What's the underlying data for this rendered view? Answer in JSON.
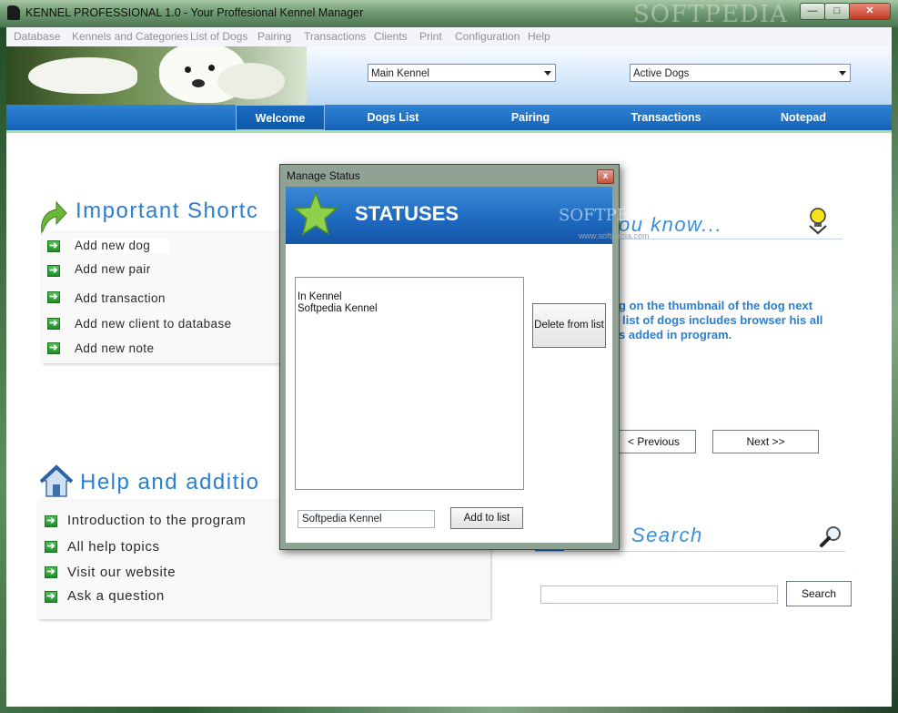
{
  "window": {
    "title": "KENNEL PROFESSIONAL 1.0 - Your Proffesional Kennel Manager",
    "watermark": "SOFTPEDIA",
    "minimize_glyph": "—",
    "maximize_glyph": "□",
    "close_glyph": "✕"
  },
  "menu": [
    "Database",
    "Kennels and Categories",
    "List of Dogs",
    "Pairing",
    "Transactions",
    "Clients",
    "Print",
    "Configuration",
    "Help"
  ],
  "header": {
    "kennel_select": "Main Kennel",
    "status_select": "Active Dogs"
  },
  "nav_tabs": [
    "Welcome",
    "Dogs List",
    "Pairing",
    "Transactions",
    "Notepad"
  ],
  "shortcuts": {
    "title": "Important Shortc",
    "items": [
      "Add new dog",
      "Add new pair",
      "Add transaction",
      "Add new client to database",
      "Add new note"
    ]
  },
  "help": {
    "title": "Help and additio",
    "items": [
      "Introduction to the program",
      "All help topics",
      "Visit our website",
      "Ask a question"
    ]
  },
  "did_you_know": {
    "title": "ou know...",
    "lines": [
      "g on the thumbnail of the dog next",
      "list of dogs includes browser his all",
      "s added in program."
    ],
    "prev_label": "< Previous",
    "next_label": "Next >>"
  },
  "search": {
    "title": "Search",
    "button_label": "Search",
    "value": ""
  },
  "dialog": {
    "title": "Manage Status",
    "close_glyph": "x",
    "banner_title": "STATUSES",
    "watermark": "SOFTPEDIA",
    "watermark_url": "www.softpedia.com",
    "list_items": [
      "In Kennel",
      "Softpedia Kennel"
    ],
    "delete_label": "Delete from list",
    "input_value": "Softpedia Kennel",
    "add_label": "Add to list"
  },
  "colors": {
    "accent_blue": "#2b7fd1",
    "nav_blue": "#1663b6",
    "icon_green": "#1f8f2a"
  }
}
